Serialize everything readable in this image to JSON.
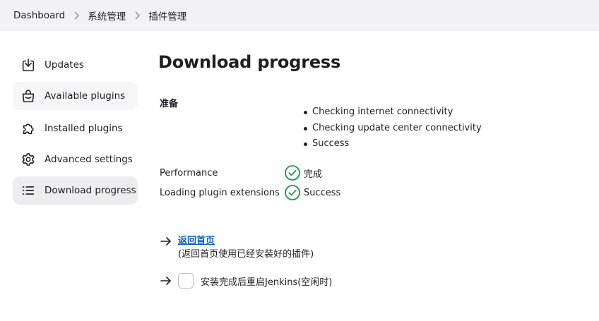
{
  "breadcrumb": {
    "items": [
      "Dashboard",
      "系统管理",
      "插件管理"
    ]
  },
  "sidebar": {
    "items": [
      {
        "label": "Updates",
        "icon": "download-icon"
      },
      {
        "label": "Available plugins",
        "icon": "shopping-bag-icon"
      },
      {
        "label": "Installed plugins",
        "icon": "puzzle-icon"
      },
      {
        "label": "Advanced settings",
        "icon": "gear-icon"
      },
      {
        "label": "Download progress",
        "icon": "list-icon"
      }
    ],
    "active_index": 4
  },
  "main": {
    "title": "Download progress",
    "preparation": {
      "label": "准备",
      "steps": [
        "Checking internet connectivity",
        "Checking update center connectivity",
        "Success"
      ]
    },
    "status_rows": [
      {
        "name": "Performance",
        "status": "完成"
      },
      {
        "name": "Loading plugin extensions",
        "status": "Success"
      }
    ],
    "home": {
      "link_label": "返回首页",
      "note": "(返回首页使用已经安装好的插件)"
    },
    "restart": {
      "label": "安装完成后重启Jenkins(空闲时)",
      "checked": false
    }
  },
  "colors": {
    "link": "#0b5ec1",
    "success": "#1a9c4c",
    "breadcrumb_bg": "#f2f2f4",
    "active_item_bg": "#ededf0"
  }
}
